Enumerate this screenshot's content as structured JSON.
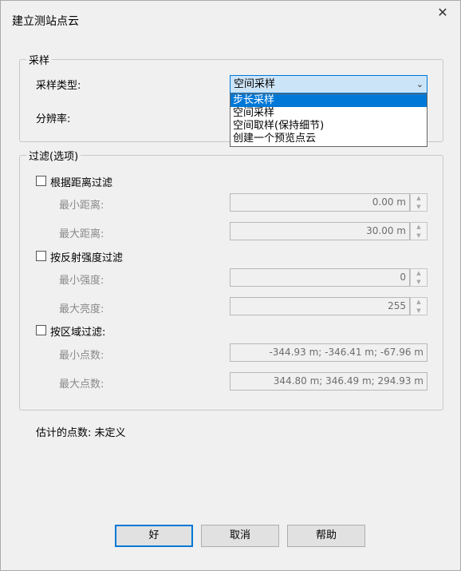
{
  "window": {
    "title": "建立测站点云",
    "close_icon": "close-icon"
  },
  "sampling": {
    "legend": "采样",
    "type_label": "采样类型:",
    "selected_value": "空间采样",
    "options": [
      "步长采样",
      "空间采样",
      "空间取样(保持细节)",
      "创建一个预览点云"
    ],
    "highlighted_option": "步长采样",
    "resolution_label": "分辨率:"
  },
  "filter": {
    "legend": "过滤(选项)",
    "distance": {
      "label": "根据距离过滤",
      "checked": false,
      "min_label": "最小距离:",
      "min_value": "0.00 m",
      "max_label": "最大距离:",
      "max_value": "30.00 m"
    },
    "intensity": {
      "label": "按反射强度过滤",
      "checked": false,
      "min_label": "最小强度:",
      "min_value": "0",
      "max_label": "最大亮度:",
      "max_value": "255"
    },
    "region": {
      "label": "按区域过滤:",
      "checked": false,
      "min_label": "最小点数:",
      "min_value": "-344.93 m; -346.41 m; -67.96 m",
      "max_label": "最大点数:",
      "max_value": "344.80 m; 346.49 m; 294.93 m"
    }
  },
  "estimate": {
    "text": "估计的点数: 未定义"
  },
  "buttons": {
    "ok": "好",
    "cancel": "取消",
    "help": "帮助"
  },
  "colors": {
    "accent": "#0078d7",
    "selection_bg": "#cce4f7",
    "dialog_bg": "#f0f0f0",
    "disabled_text": "#8a8a8a"
  }
}
